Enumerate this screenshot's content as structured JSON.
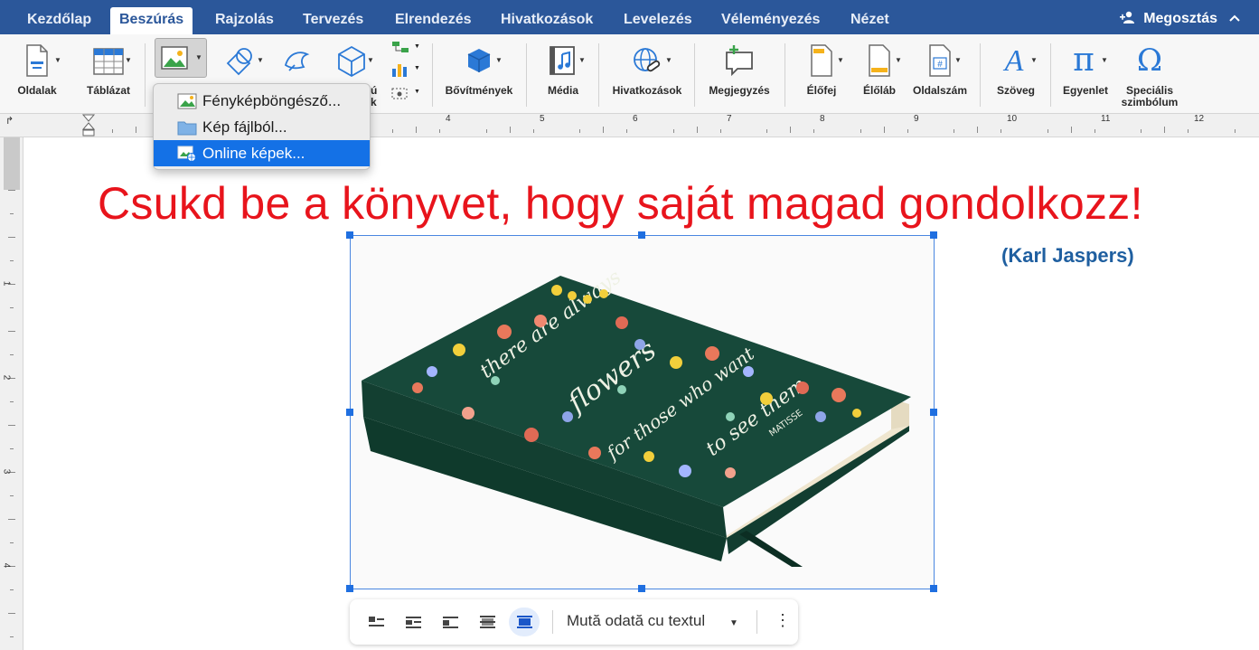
{
  "tabs": [
    {
      "label": "Kezdőlap",
      "active": false
    },
    {
      "label": "Beszúrás",
      "active": true
    },
    {
      "label": "Rajzolás",
      "active": false
    },
    {
      "label": "Tervezés",
      "active": false
    },
    {
      "label": "Elrendezés",
      "active": false
    },
    {
      "label": "Hivatkozások",
      "active": false
    },
    {
      "label": "Levelezés",
      "active": false
    },
    {
      "label": "Véleményezés",
      "active": false
    },
    {
      "label": "Nézet",
      "active": false
    }
  ],
  "share_label": "Megosztás",
  "ribbon": {
    "pages": "Oldalak",
    "table": "Táblázat",
    "addins": "Bővítmények",
    "media": "Média",
    "links": "Hivatkozások",
    "comment": "Megjegyzés",
    "header": "Élőfej",
    "footer": "Élőláb",
    "page_number": "Oldalszám",
    "text": "Szöveg",
    "equation": "Egyenlet",
    "symbol_line1": "Speciális",
    "symbol_line2": "szimbólum",
    "smartart_partial_1": "ú",
    "smartart_partial_2": "k"
  },
  "picture_menu": {
    "items": [
      {
        "label": "Fényképböngésző...",
        "selected": false
      },
      {
        "label": "Kép fájlból...",
        "selected": false
      },
      {
        "label": "Online képek...",
        "selected": true
      }
    ]
  },
  "ruler": {
    "numbers": [
      "4",
      "5",
      "6",
      "7",
      "8",
      "9",
      "10",
      "11",
      "12"
    ]
  },
  "vruler": {
    "numbers": [
      "1",
      "2",
      "3",
      "4"
    ]
  },
  "document": {
    "quote": "Csukd be a könyvet, hogy saját magad gondolkozz!",
    "author": "(Karl Jaspers)",
    "book_cover_text": [
      "there are always",
      "flowers",
      "for those who want",
      "to see them",
      "MATISSE"
    ]
  },
  "image_toolbar": {
    "move_with_text": "Mută odată cu textul",
    "active_wrap_index": 4
  },
  "colors": {
    "brand_blue": "#2b579a",
    "quote_red": "#e8141c",
    "author_blue": "#1f5fa0",
    "selection_blue": "#1471e6",
    "book_green": "#17493a"
  }
}
